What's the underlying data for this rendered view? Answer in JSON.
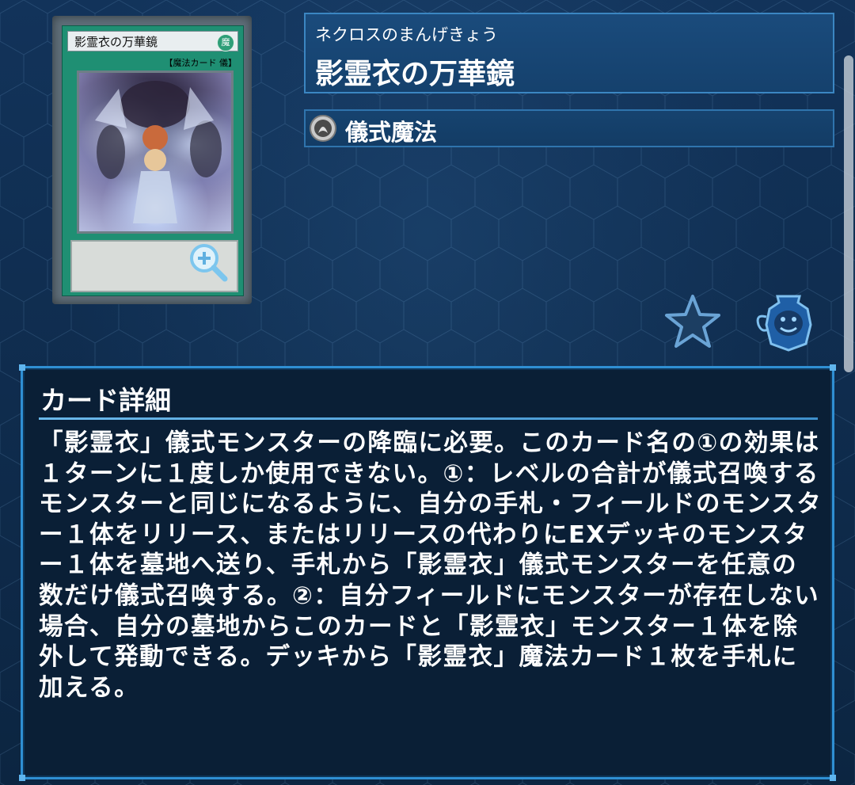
{
  "card": {
    "name_reading": "ネクロスのまんげきょう",
    "name": "影霊衣の万華鏡",
    "card_image_name": "影霊衣の万華鏡",
    "card_image_attribute": "魔",
    "card_image_type_line": "【魔法カード 儀】",
    "spell_type": "儀式魔法",
    "spell_type_icon": "ritual-spell-icon"
  },
  "actions": {
    "zoom_icon": "magnify-plus-icon",
    "favorite_icon": "star-icon",
    "deck_jar_icon": "pot-of-greed-icon"
  },
  "detail": {
    "title": "カード詳細",
    "text": "「影霊衣」儀式モンスターの降臨に必要。このカード名の①の効果は１ターンに１度しか使用できない。①：レベルの合計が儀式召喚するモンスターと同じになるように、自分の手札・フィールドのモンスター１体をリリース、またはリリースの代わりにEXデッキのモンスター１体を墓地へ送り、手札から「影霊衣」儀式モンスターを任意の数だけ儀式召喚する。②：自分フィールドにモンスターが存在しない場合、自分の墓地からこのカードと「影霊衣」モンスター１体を除外して発動できる。デッキから「影霊衣」魔法カード１枚を手札に加える。"
  },
  "colors": {
    "background": "#0e2a48",
    "panel_border": "#2f8fd3",
    "card_frame_spell": "#1f8f73",
    "text": "#ffffff"
  }
}
